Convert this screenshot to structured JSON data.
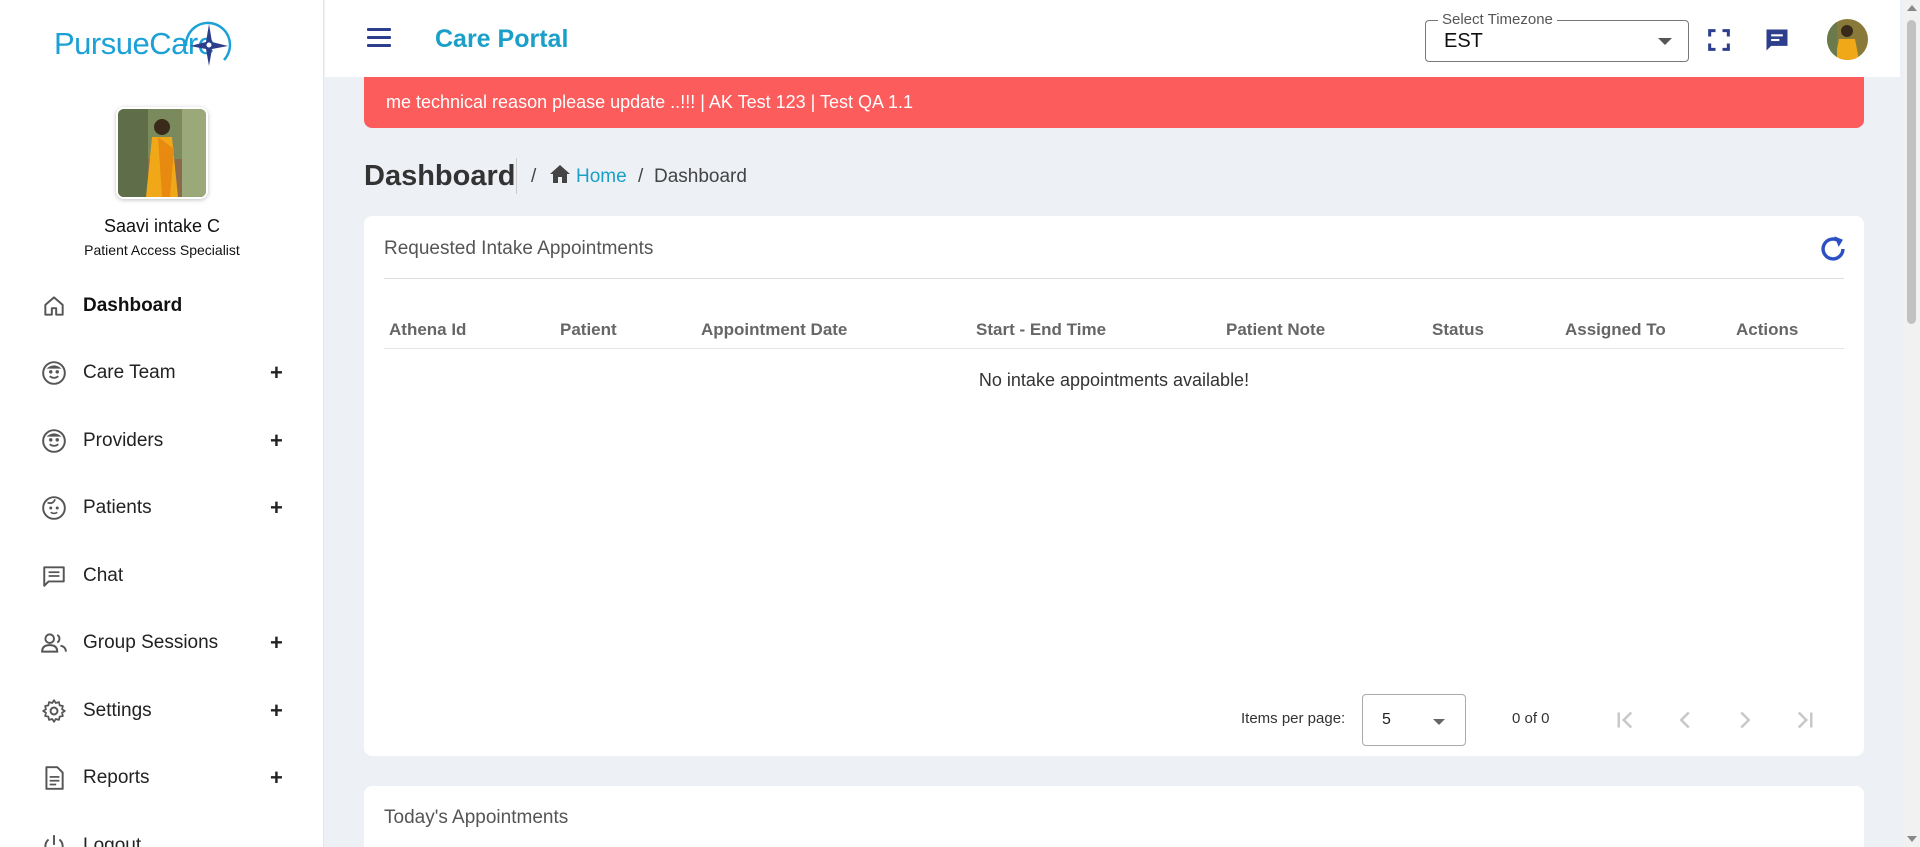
{
  "brand": {
    "name": "PursueCare"
  },
  "user": {
    "name": "Saavi intake C",
    "role": "Patient Access Specialist"
  },
  "nav": [
    {
      "label": "Dashboard",
      "icon": "home-icon",
      "expandable": false,
      "active": true
    },
    {
      "label": "Care Team",
      "icon": "care-team-icon",
      "expandable": true
    },
    {
      "label": "Providers",
      "icon": "providers-icon",
      "expandable": true
    },
    {
      "label": "Patients",
      "icon": "patients-icon",
      "expandable": true
    },
    {
      "label": "Chat",
      "icon": "chat-icon",
      "expandable": false
    },
    {
      "label": "Group Sessions",
      "icon": "group-icon",
      "expandable": true
    },
    {
      "label": "Settings",
      "icon": "gear-icon",
      "expandable": true
    },
    {
      "label": "Reports",
      "icon": "report-icon",
      "expandable": true
    },
    {
      "label": "Logout",
      "icon": "power-icon",
      "expandable": false
    }
  ],
  "nav_plus": "+",
  "header": {
    "title": "Care Portal",
    "timezone_label": "Select Timezone",
    "timezone_value": "EST"
  },
  "banner": {
    "text": "me technical reason please update ..!!! | AK Test 123 | Test QA 1.1"
  },
  "page": {
    "title": "Dashboard",
    "breadcrumb_sep": "/",
    "breadcrumb_home": "Home",
    "breadcrumb_current": "Dashboard"
  },
  "intake_card": {
    "title": "Requested Intake Appointments",
    "columns": [
      "Athena Id",
      "Patient",
      "Appointment Date",
      "Start - End Time",
      "Patient Note",
      "Status",
      "Assigned To",
      "Actions"
    ],
    "empty_message": "No intake appointments available!",
    "items_per_page_label": "Items per page:",
    "items_per_page": "5",
    "range": "0 of 0"
  },
  "today_card": {
    "title": "Today's Appointments"
  },
  "colors": {
    "accent": "#1aa0c8",
    "banner": "#fc5c5c",
    "icon_blue": "#2c3e8c"
  }
}
